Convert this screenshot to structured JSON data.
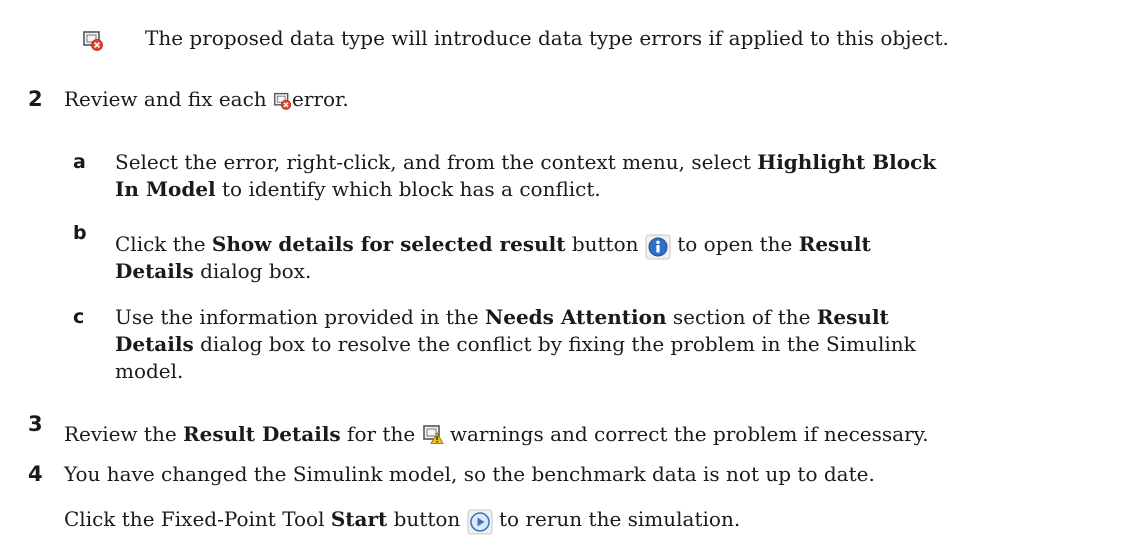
{
  "legend": {
    "text": "The proposed data type will introduce data type errors if applied to this object."
  },
  "steps": [
    {
      "number": "2",
      "text_before": "Review and fix each",
      "text_after": "error.",
      "substeps": [
        {
          "letter": "a",
          "t1": "Select the error, right-click, and from the context menu, select",
          "b1": "Highlight Block",
          "b2": "In Model",
          "t2": "to identify which block has a conflict."
        },
        {
          "letter": "b",
          "t1": "Click the",
          "b1": "Show details for selected result",
          "t2": "button",
          "t3": "to open the",
          "b2": "Result",
          "b3": "Details",
          "t4": "dialog box."
        },
        {
          "letter": "c",
          "t1": "Use the information provided in the",
          "b1": "Needs Attention",
          "t2": "section of the",
          "b2": "Result",
          "b3": "Details",
          "t3": "dialog box to resolve the conflict by fixing the problem in the Simulink",
          "t4": "model."
        }
      ]
    },
    {
      "number": "3",
      "t1": "Review the",
      "b1": "Result Details",
      "t2": "for the",
      "t3": "warnings and correct the problem if necessary."
    },
    {
      "number": "4",
      "line1": "You have changed the Simulink model, so the benchmark data is not up to date.",
      "t1": "Click the Fixed-Point Tool",
      "b1": "Start",
      "t2": "button",
      "t3": "to rerun the simulation."
    }
  ],
  "icons": {
    "error": "error-block-icon",
    "warning": "warning-block-icon",
    "info": "info-button-icon",
    "start": "start-button-icon"
  },
  "colors": {
    "error_badge": "#e2462a",
    "warning_badge": "#f2c21a",
    "info_blue": "#2f6fc6",
    "start_blue": "#3a78c4"
  }
}
